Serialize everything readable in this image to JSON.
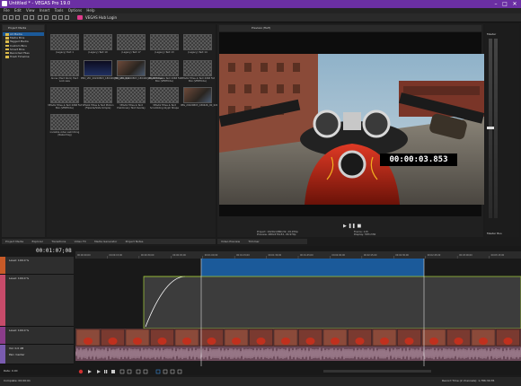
{
  "window": {
    "title": "Untitled * - VEGAS Pro 19.0",
    "controls": [
      "–",
      "□",
      "✕"
    ]
  },
  "menu": [
    "File",
    "Edit",
    "View",
    "Insert",
    "Tools",
    "Options",
    "Help"
  ],
  "toolbar": {
    "hub_label": "VEGAS Hub Login"
  },
  "explorer": {
    "title": "Project Media",
    "tree": [
      "All Media",
      "Media Bins",
      "Tagged Media",
      "Custom Bins",
      "Smart Bins",
      "Recorded Files",
      "Trash Timeline"
    ]
  },
  "media": {
    "items": [
      {
        "caption": "(Legacy) Text 1"
      },
      {
        "caption": "(Legacy) Text 10"
      },
      {
        "caption": "(Legacy) Text 17"
      },
      {
        "caption": "(Legacy) Text 13"
      },
      {
        "caption": "(Legacy) Text 14"
      },
      {
        "caption": "Alone (Hard Rock) Hard Lock.wav"
      },
      {
        "caption": "PRO_VID_20220803_180426_00_036.mp4"
      },
      {
        "caption": "PRO_VID_20220803_180426_00_038.mp4"
      },
      {
        "caption": "VEGAS Titles & Text 2068 Fat Box (VERTICAL)"
      },
      {
        "caption": "VEGAS Titles & Text 2068 Fat Box (VERTICAL)"
      },
      {
        "caption": "VEGAS Titles & Text 2068 Fat Box (VERTICAL)"
      },
      {
        "caption": "VEGAS Titles & Text Motion (Flipside/Slide Simple)"
      },
      {
        "caption": "VEGAS Titles & Text Preliminary Text Overlay"
      },
      {
        "caption": "VEGAS Titles & Text Scrambling Glyph Shape"
      },
      {
        "caption": "IMG_20220803_180426_00_029.jpg"
      },
      {
        "caption": "invisible video swimming (Naked tag)"
      }
    ]
  },
  "preview": {
    "mode": "Preview (Half)",
    "timecode_overlay": "00:00:03.853",
    "info": {
      "project": "Project: 1920x1080x32, 29.970p",
      "preview": "Preview: 480x270x32, 29.970p",
      "frame": "Frame: 115",
      "display": "Display: 587x330"
    },
    "tabs": [
      "Video Preview",
      "Trimmer"
    ]
  },
  "master": {
    "label": "Master",
    "bus_label": "Master Bus"
  },
  "left_tabs": [
    "Project Media",
    "Explorer",
    "Transitions",
    "Video FX",
    "Media Generator",
    "Project Notes"
  ],
  "timeline": {
    "timecode": "00:01:07;08",
    "ruler_labels": [
      "00:00:00;00",
      "00:00:15;00",
      "00:00:30;00",
      "00:00:45;00",
      "00:01:00;00",
      "00:01:15;00",
      "00:01:30;00",
      "00:01:45;00",
      "00:02:00;00",
      "00:02:15;00",
      "00:02:30;00",
      "00:02:45;00",
      "00:03:00;00",
      "00:03:15;00"
    ],
    "tracks": [
      {
        "level": "Level: 100.0 %",
        "color": "#c85a28"
      },
      {
        "level": "Level: 100.0 %",
        "color": "#c74b6a"
      },
      {
        "level": "Level: 100.0 %",
        "color": "#8b3c8a"
      },
      {
        "level": "Vol: 0.0 dB",
        "pan": "Pan: Center",
        "color": "#7a5cb0"
      }
    ],
    "rate_label": "Rate: 0.00"
  },
  "statusbar": {
    "left": "Complete: 00:00:01",
    "right": "Record Time (2 channels): 1,786:30:35"
  },
  "colors": {
    "titlebar": "#6b2fa3",
    "selection": "#1b5a9a"
  }
}
